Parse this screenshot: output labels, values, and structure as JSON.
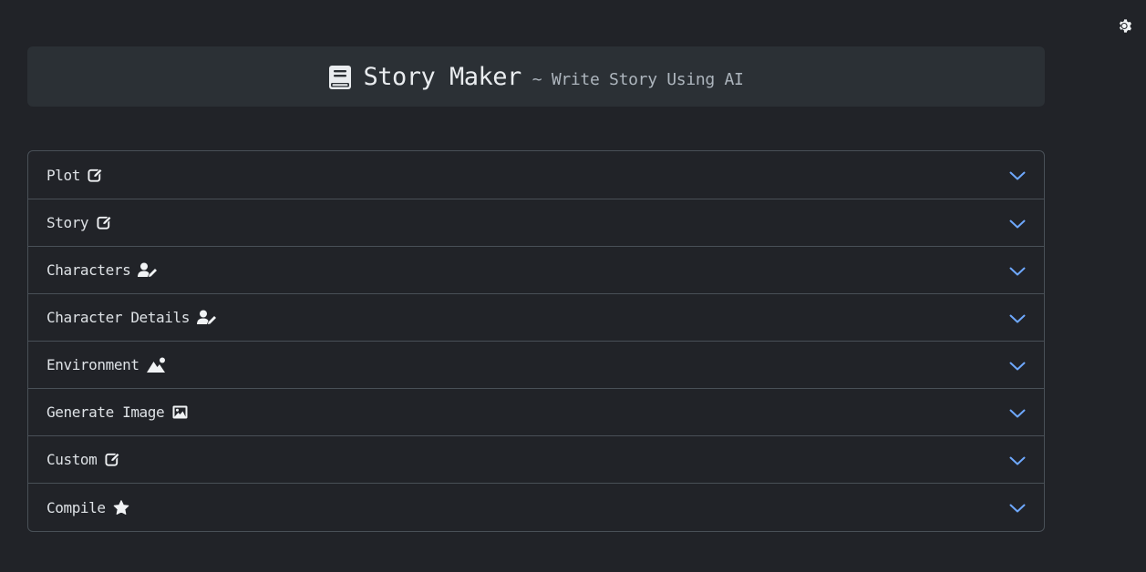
{
  "header": {
    "title": "Story Maker",
    "subtitle": "~ Write Story Using AI",
    "icon": "book-icon"
  },
  "settings": {
    "icon": "gear-icon"
  },
  "accordion": {
    "items": [
      {
        "label": "Plot",
        "icon": "edit-icon"
      },
      {
        "label": "Story",
        "icon": "edit-icon"
      },
      {
        "label": "Characters",
        "icon": "user-pen-icon"
      },
      {
        "label": "Character Details",
        "icon": "user-pen-icon"
      },
      {
        "label": "Environment",
        "icon": "mountain-sun-icon"
      },
      {
        "label": "Generate Image",
        "icon": "image-icon"
      },
      {
        "label": "Custom",
        "icon": "edit-icon"
      },
      {
        "label": "Compile",
        "icon": "star-icon"
      }
    ]
  },
  "colors": {
    "background": "#212328",
    "header_background": "#2b3035",
    "border": "#495057",
    "chevron": "#6ea8fe",
    "text": "#dee2e6"
  }
}
